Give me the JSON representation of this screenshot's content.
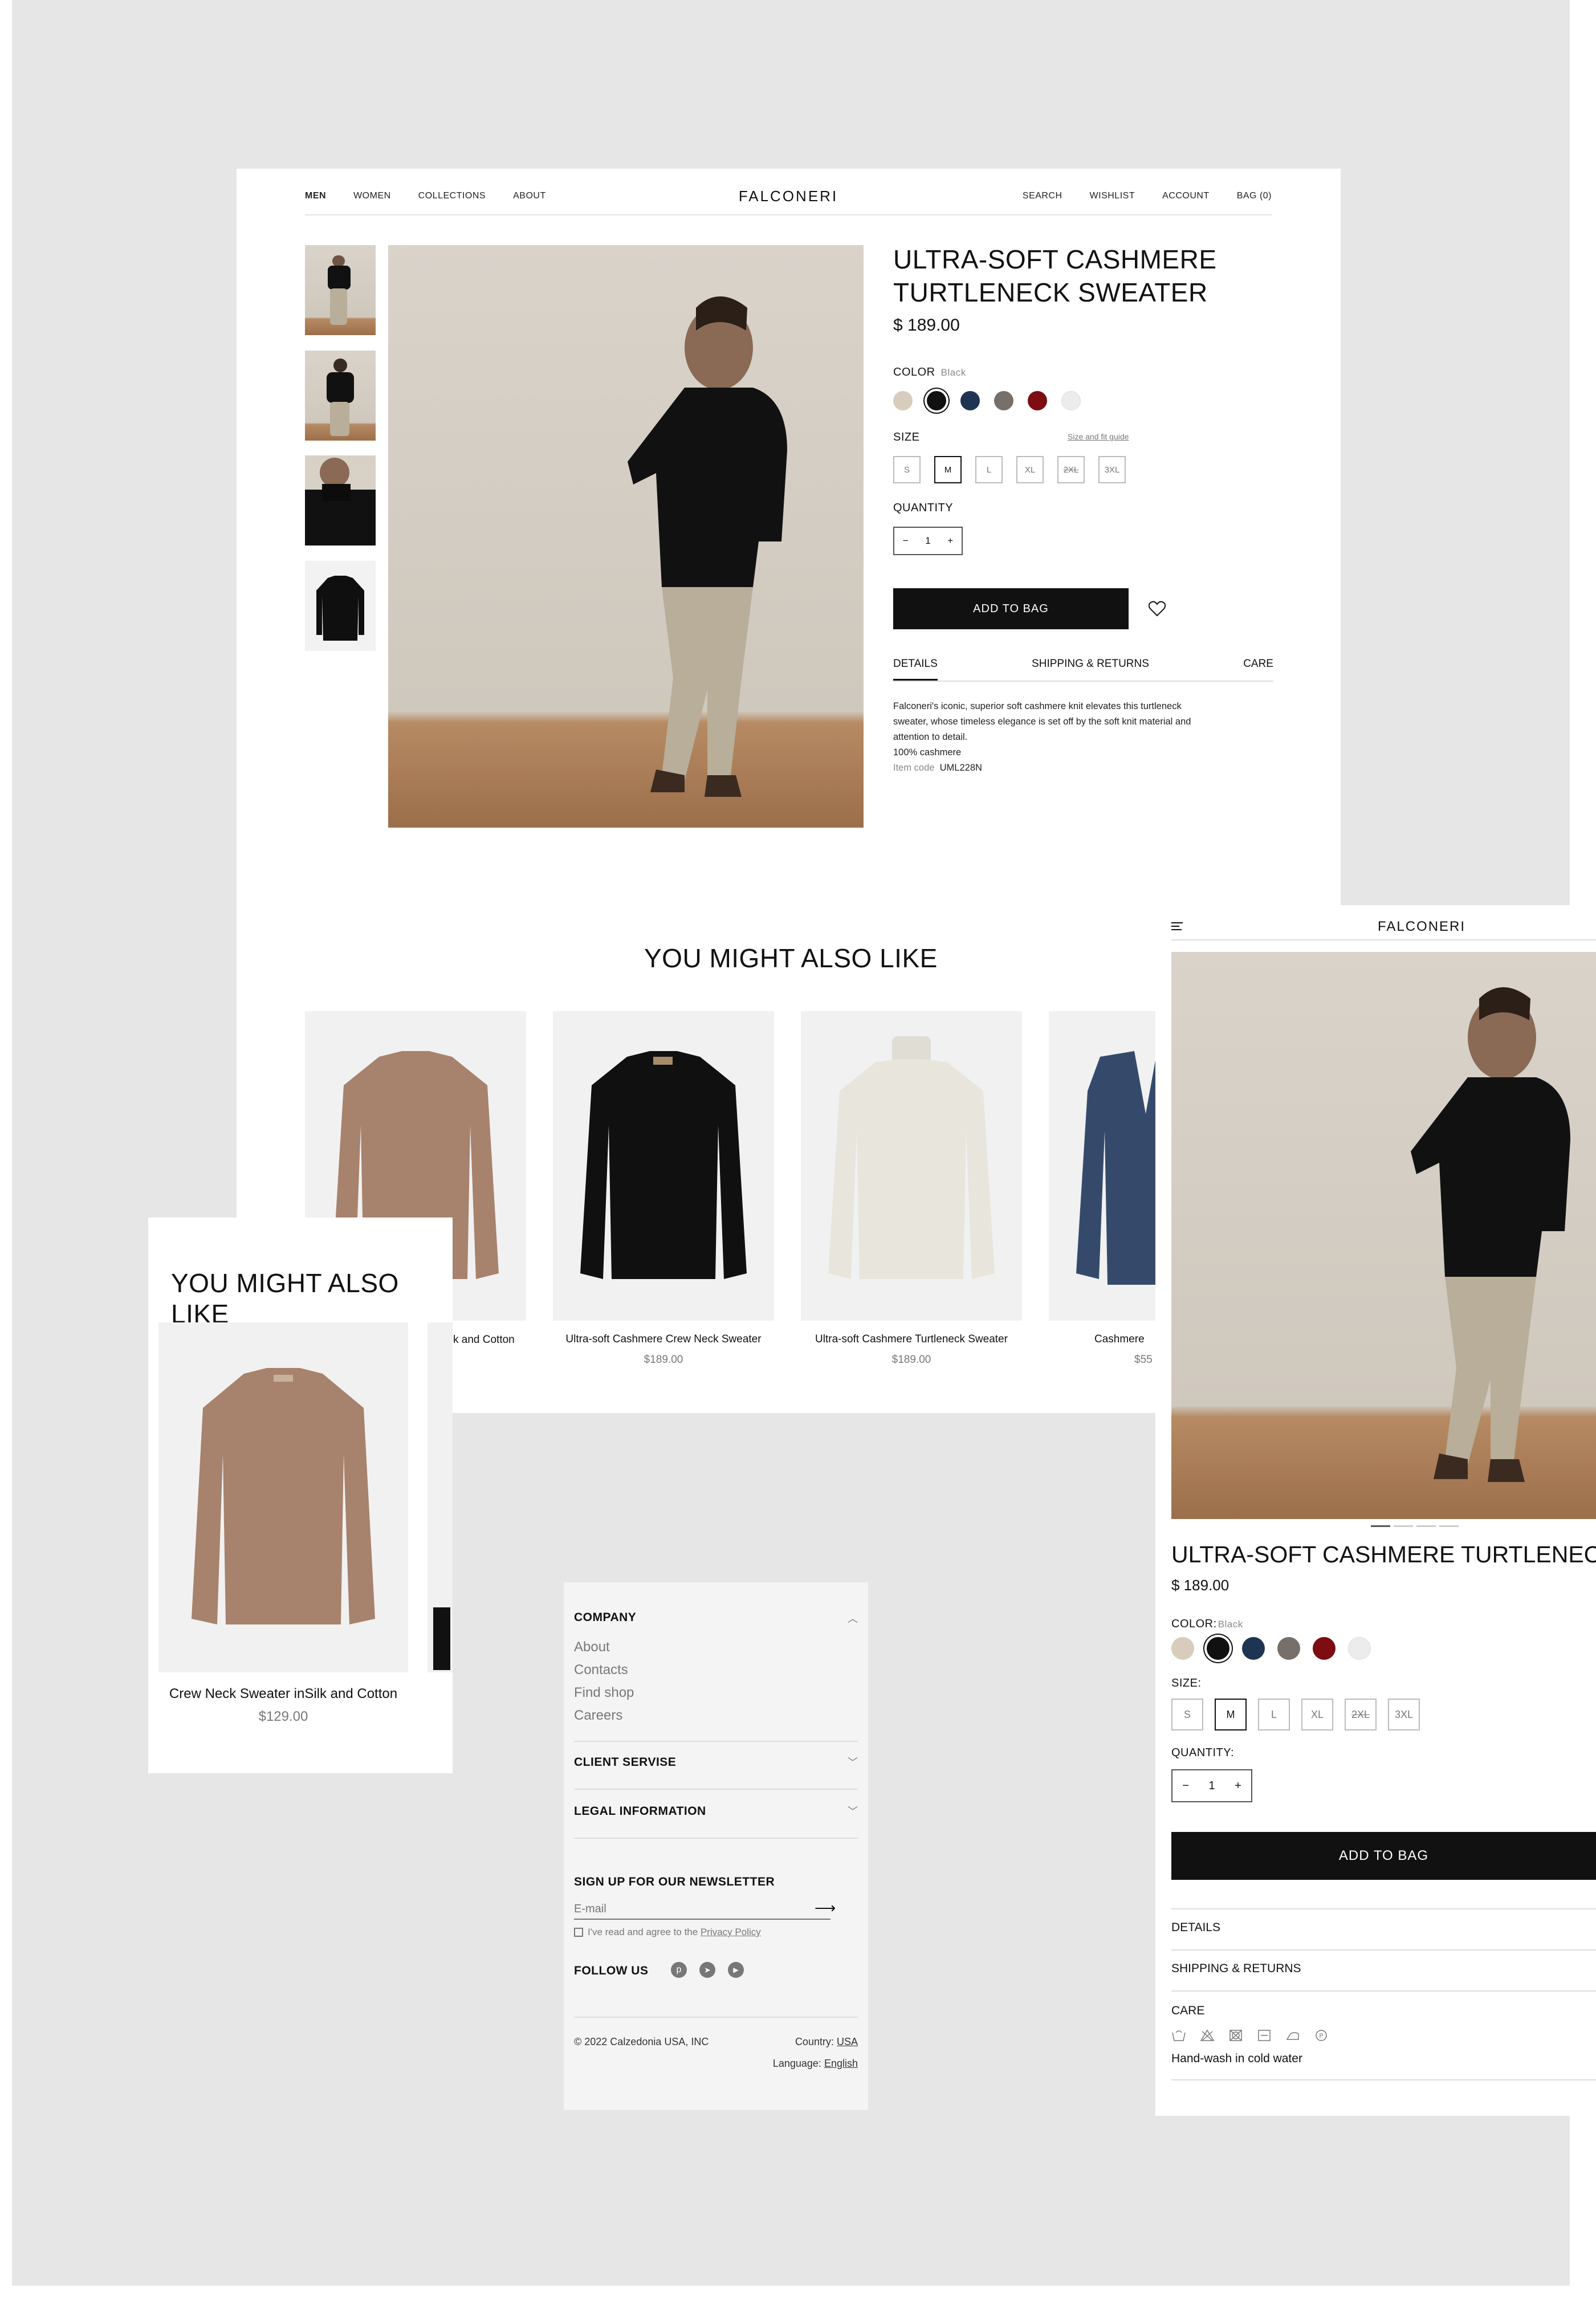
{
  "desktop": {
    "nav": {
      "left": [
        "MEN",
        "WOMEN",
        "COLLECTIONS",
        "ABOUT"
      ],
      "logo": "FALCONERI",
      "right": [
        "SEARCH",
        "WISHLIST",
        "ACCOUNT",
        "BAG (0)"
      ]
    },
    "product": {
      "title_line1": "ULTRA-SOFT CASHMERE",
      "title_line2": "TURTLENECK SWEATER",
      "price": "$ 189.00",
      "color_label": "COLOR",
      "color_selected": "Black",
      "size_label": "SIZE",
      "size_guide": "Size and fit guide",
      "quantity_label": "QUANTITY",
      "quantity": "1",
      "add_to_bag": "ADD TO BAG",
      "tabs": [
        "DETAILS",
        "SHIPPING & RETURNS",
        "CARE"
      ],
      "description": "Falconeri's iconic, superior soft cashmere knit elevates this turtleneck sweater, whose timeless elegance is set off by the soft knit material and attention to detail.",
      "composition": "100% cashmere",
      "item_code_label": "Item code",
      "item_code": "UML228N"
    },
    "yml_title": "YOU MIGHT ALSO LIKE",
    "recommendations": [
      {
        "name": "k and Cotton",
        "price": ""
      },
      {
        "name": "Ultra-soft Cashmere Crew Neck Sweater",
        "price": "$189.00"
      },
      {
        "name": "Ultra-soft Cashmere Turtleneck Sweater",
        "price": "$189.00"
      },
      {
        "name": "Cashmere",
        "price": "$55"
      }
    ]
  },
  "colors": [
    "#d8ccbc",
    "#111111",
    "#1e3452",
    "#77706a",
    "#7d0d10",
    "#ececec"
  ],
  "sizes": [
    {
      "label": "S",
      "state": "available"
    },
    {
      "label": "M",
      "state": "selected"
    },
    {
      "label": "L",
      "state": "available"
    },
    {
      "label": "XL",
      "state": "available"
    },
    {
      "label": "2XL",
      "state": "unavailable"
    },
    {
      "label": "3XL",
      "state": "available"
    }
  ],
  "mobile": {
    "logo": "FALCONERI",
    "title": "ULTRA-SOFT CASHMERE TURTLENECK SWE",
    "price": "$ 189.00",
    "color_label": "COLOR:",
    "color_selected": "Black",
    "size_label": "SIZE:",
    "quantity_label": "QUANTITY:",
    "quantity": "1",
    "add_to_bag": "ADD TO BAG",
    "sections": [
      "DETAILS",
      "SHIPPING & RETURNS",
      "CARE"
    ],
    "care_text": "Hand-wash in cold water",
    "care_icons": [
      "handwash-icon",
      "no-bleach-icon",
      "no-tumble-dry-icon",
      "dry-flat-icon",
      "iron-low-icon",
      "dry-clean-icon"
    ]
  },
  "mobile_yml": {
    "title": "YOU MIGHT ALSO LIKE",
    "product_name": "Crew Neck Sweater inSilk and Cotton",
    "product_price": "$129.00"
  },
  "footer": {
    "company_label": "COMPANY",
    "company_links": [
      "About",
      "Contacts",
      "Find shop",
      "Careers"
    ],
    "client_service": "CLIENT SERVISE",
    "legal": "LEGAL INFORMATION",
    "newsletter_label": "SIGN UP FOR OUR NEWSLETTER",
    "email_placeholder": "E-mail",
    "consent_text": "I've read and agree to the",
    "privacy_link": "Privacy Policy",
    "follow_label": "FOLLOW US",
    "copyright": "© 2022  Calzedonia USA, INC",
    "country_label": "Country:",
    "country": "USA",
    "language_label": "Language:",
    "language": "English"
  }
}
